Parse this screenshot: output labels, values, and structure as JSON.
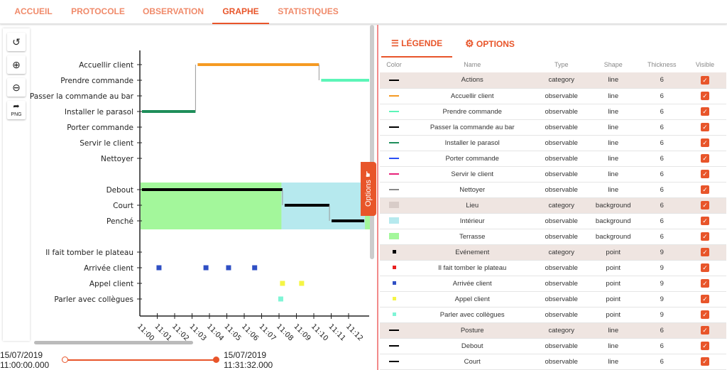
{
  "tabs": [
    {
      "label": "ACCUEIL"
    },
    {
      "label": "PROTOCOLE"
    },
    {
      "label": "OBSERVATION"
    },
    {
      "label": "GRAPHE",
      "active": true
    },
    {
      "label": "STATISTIQUES"
    }
  ],
  "toolbar": {
    "reset": "reset-icon",
    "zoom_in": "zoom-in-icon",
    "zoom_out": "zoom-out-icon",
    "export": "PNG"
  },
  "options_tab": "Options",
  "chart_data": {
    "type": "timeline",
    "x_ticks": [
      "11:00",
      "11:01",
      "11:02",
      "11:03",
      "11:04",
      "11:05",
      "11:06",
      "11:07",
      "11:08",
      "11:09",
      "11:10",
      "11:11",
      "11:12"
    ],
    "x_unit": "minutes after 11:00",
    "categories": [
      {
        "name": "Actions",
        "rows": [
          "Accuellir client",
          "Prendre commande",
          "Passer la commande au bar",
          "Installer le parasol",
          "Porter commande",
          "Servir le client",
          "Nettoyer"
        ],
        "segments": [
          {
            "row": "Installer le parasol",
            "start": 0,
            "end": 3.2,
            "color": "#1e8e5a"
          },
          {
            "row": "Accuellir client",
            "start": 3.2,
            "end": 10.3,
            "color": "#f59a23"
          },
          {
            "row": "Prendre commande",
            "start": 10.3,
            "end": 13.4,
            "color": "#5cf5b8"
          }
        ]
      },
      {
        "name": "Posture",
        "rows": [
          "Debout",
          "Court",
          "Penché"
        ],
        "background": [
          {
            "name": "Terrasse",
            "start": 0,
            "end": 8.1,
            "color": "#a3f79b"
          },
          {
            "name": "Intérieur",
            "start": 8.1,
            "end": 12.9,
            "color": "#b6e9ee"
          },
          {
            "name": "Terrasse",
            "start": 12.9,
            "end": 13.4,
            "color": "#a3f79b"
          }
        ],
        "segments": [
          {
            "row": "Debout",
            "start": 0,
            "end": 8.2,
            "color": "#000000"
          },
          {
            "row": "Court",
            "start": 8.2,
            "end": 10.9,
            "color": "#000000"
          },
          {
            "row": "Penché",
            "start": 10.9,
            "end": 12.9,
            "color": "#000000"
          }
        ]
      },
      {
        "name": "Evénement",
        "rows": [
          "Il fait tomber le plateau",
          "Arrivée client",
          "Appel client",
          "Parler avec collègues"
        ],
        "points": [
          {
            "row": "Arrivée client",
            "t": [
              1.1,
              3.8,
              5.1,
              6.6
            ],
            "color": "#2f4fc4"
          },
          {
            "row": "Appel client",
            "t": [
              8.2,
              9.3
            ],
            "color": "#f5f545"
          },
          {
            "row": "Parler avec collègues",
            "t": [
              8.1
            ],
            "color": "#7ff5d6"
          }
        ]
      }
    ]
  },
  "range": {
    "start_date": "15/07/2019",
    "start_time": "11:00:00.000",
    "end_date": "15/07/2019",
    "end_time": "11:31:32.000"
  },
  "legend": {
    "tab_legend": "LÉGENDE",
    "tab_options": "OPTIONS",
    "headers": [
      "Color",
      "Name",
      "Type",
      "Shape",
      "Thickness",
      "Visible"
    ],
    "rows": [
      {
        "color": "#000000",
        "name": "Actions",
        "type": "category",
        "shape": "line",
        "thickness": "6",
        "cat": true
      },
      {
        "color": "#f59a23",
        "name": "Accuellir client",
        "type": "observable",
        "shape": "line",
        "thickness": "6"
      },
      {
        "color": "#5cf5b8",
        "name": "Prendre commande",
        "type": "observable",
        "shape": "line",
        "thickness": "6"
      },
      {
        "color": "#000000",
        "name": "Passer la commande au bar",
        "type": "observable",
        "shape": "line",
        "thickness": "6"
      },
      {
        "color": "#1e8e5a",
        "name": "Installer le parasol",
        "type": "observable",
        "shape": "line",
        "thickness": "6"
      },
      {
        "color": "#2a4ff5",
        "name": "Porter commande",
        "type": "observable",
        "shape": "line",
        "thickness": "6"
      },
      {
        "color": "#e8237a",
        "name": "Servir le client",
        "type": "observable",
        "shape": "line",
        "thickness": "6"
      },
      {
        "color": "#888888",
        "name": "Nettoyer",
        "type": "observable",
        "shape": "line",
        "thickness": "6"
      },
      {
        "color": "#d8ccc8",
        "name": "Lieu",
        "type": "category",
        "shape": "background",
        "thickness": "6",
        "cat": true
      },
      {
        "color": "#b6e9ee",
        "name": "Intérieur",
        "type": "observable",
        "shape": "background",
        "thickness": "6"
      },
      {
        "color": "#a3f79b",
        "name": "Terrasse",
        "type": "observable",
        "shape": "background",
        "thickness": "6"
      },
      {
        "color": "#000000",
        "name": "Evénement",
        "type": "category",
        "shape": "point",
        "thickness": "9",
        "cat": true
      },
      {
        "color": "#e82020",
        "name": "Il fait tomber le plateau",
        "type": "observable",
        "shape": "point",
        "thickness": "9"
      },
      {
        "color": "#2f4fc4",
        "name": "Arrivée client",
        "type": "observable",
        "shape": "point",
        "thickness": "9"
      },
      {
        "color": "#f5f545",
        "name": "Appel client",
        "type": "observable",
        "shape": "point",
        "thickness": "9"
      },
      {
        "color": "#7ff5d6",
        "name": "Parler avec collègues",
        "type": "observable",
        "shape": "point",
        "thickness": "9"
      },
      {
        "color": "#000000",
        "name": "Posture",
        "type": "category",
        "shape": "line",
        "thickness": "6",
        "cat": true
      },
      {
        "color": "#000000",
        "name": "Debout",
        "type": "observable",
        "shape": "line",
        "thickness": "6"
      },
      {
        "color": "#000000",
        "name": "Court",
        "type": "observable",
        "shape": "line",
        "thickness": "6"
      }
    ]
  }
}
